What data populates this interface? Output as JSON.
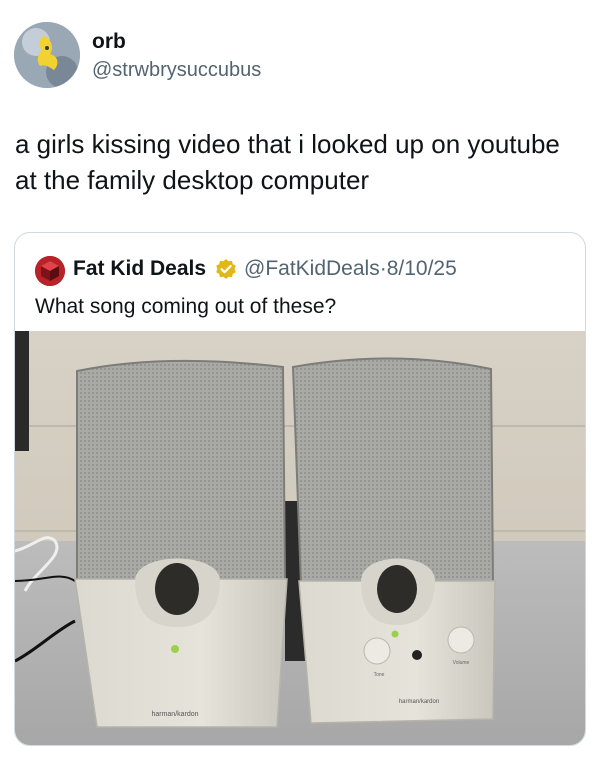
{
  "author": {
    "display_name": "orb",
    "handle": "@strwbrysuccubus",
    "avatar_icon": "avatar-icon"
  },
  "tweet": {
    "text": "a girls kissing video that i looked up on youtube at the family desktop computer"
  },
  "quoted": {
    "display_name": "Fat Kid Deals",
    "handle": "@FatKidDeals",
    "date": "8/10/25",
    "separator": "·",
    "text": "What song coming out of these?",
    "verified_color": "#e2b719"
  },
  "photo": {
    "speaker_brand": "harman/kardon",
    "tone_label": "Tone",
    "volume_label": "Volume"
  }
}
